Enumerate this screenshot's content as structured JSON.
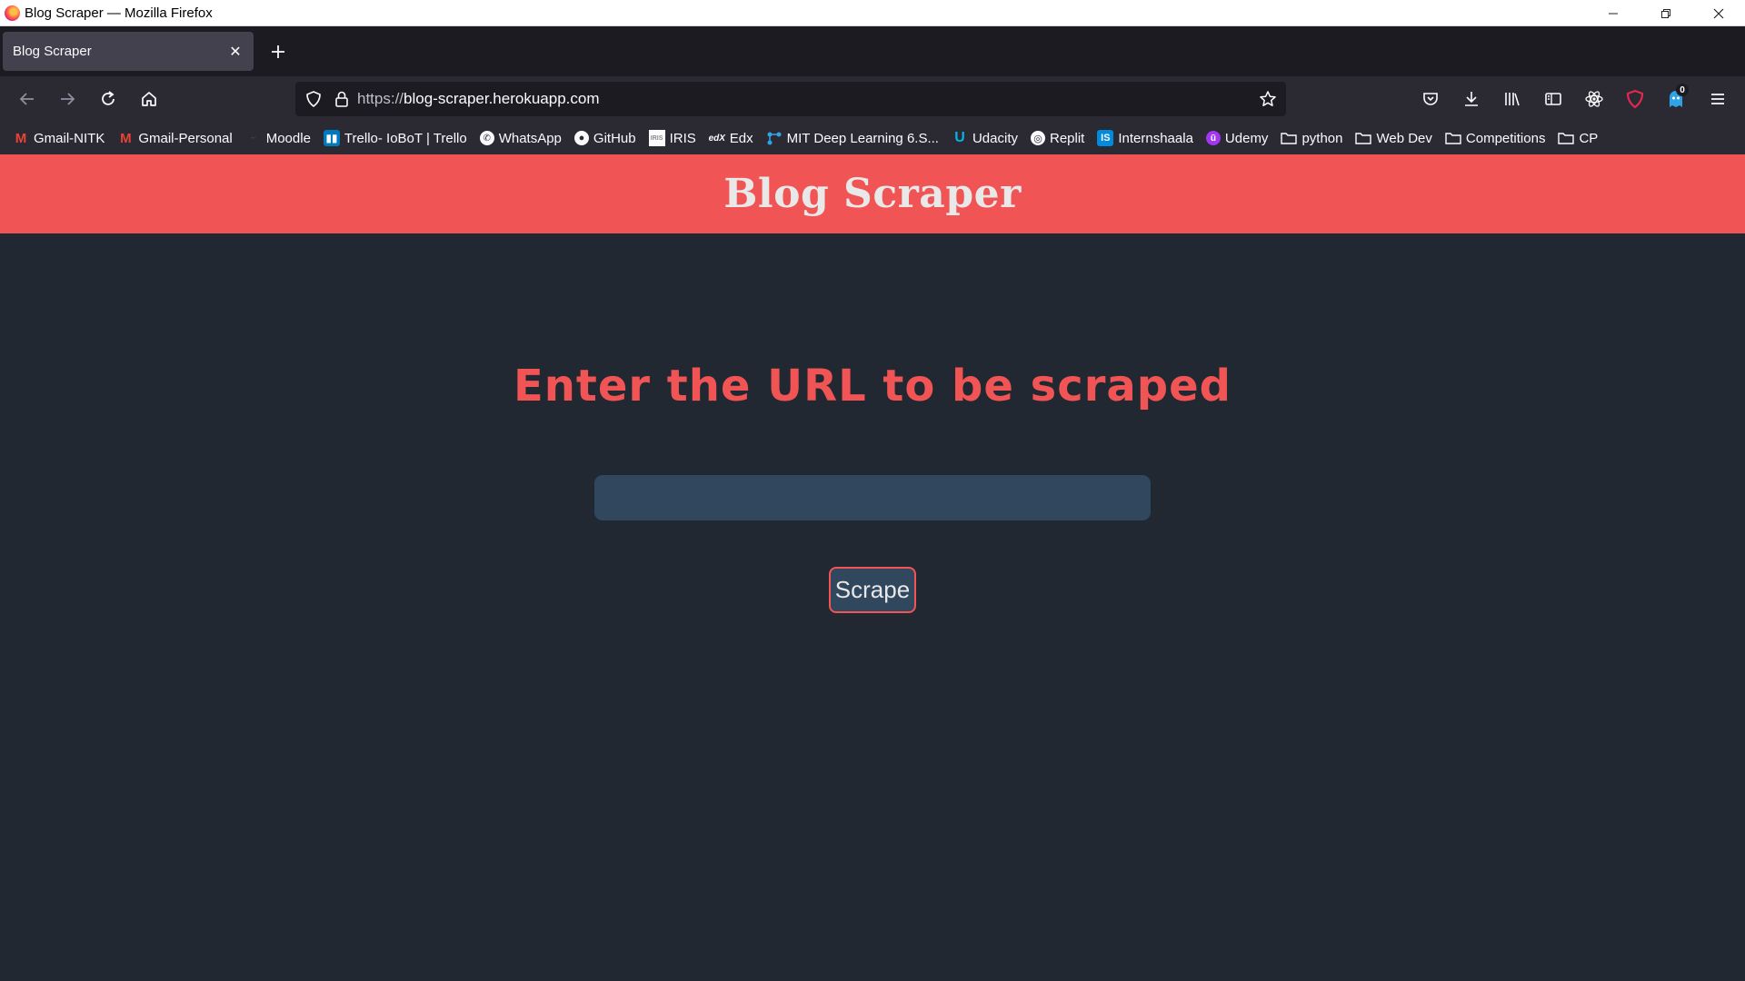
{
  "window": {
    "title": "Blog Scraper — Mozilla Firefox"
  },
  "tabs": [
    {
      "label": "Blog Scraper",
      "active": true
    }
  ],
  "address_bar": {
    "scheme": "https://",
    "host": "blog-scraper.herokuapp.com"
  },
  "toolbar": {
    "notification_count": "0"
  },
  "bookmarks": [
    {
      "label": "Gmail-NITK",
      "icon": "gmail-icon"
    },
    {
      "label": "Gmail-Personal",
      "icon": "gmail-icon"
    },
    {
      "label": "Moodle",
      "icon": "moodle-icon"
    },
    {
      "label": "Trello- IoBoT | Trello",
      "icon": "trello-icon"
    },
    {
      "label": "WhatsApp",
      "icon": "whatsapp-icon"
    },
    {
      "label": "GitHub",
      "icon": "github-icon"
    },
    {
      "label": "IRIS",
      "icon": "iris-icon"
    },
    {
      "label": "Edx",
      "icon": "edx-icon"
    },
    {
      "label": "MIT Deep Learning 6.S...",
      "icon": "mit-icon"
    },
    {
      "label": "Udacity",
      "icon": "udacity-icon"
    },
    {
      "label": "Replit",
      "icon": "replit-icon"
    },
    {
      "label": "Internshaala",
      "icon": "internshala-icon"
    },
    {
      "label": "Udemy",
      "icon": "udemy-icon"
    },
    {
      "label": "python",
      "icon": "folder-icon"
    },
    {
      "label": "Web Dev",
      "icon": "folder-icon"
    },
    {
      "label": "Competitions",
      "icon": "folder-icon"
    },
    {
      "label": "CP",
      "icon": "folder-icon"
    }
  ],
  "page": {
    "header_title": "Blog Scraper",
    "prompt": "Enter the URL to be scraped",
    "url_input_value": "",
    "scrape_button_label": "Scrape"
  },
  "colors": {
    "page_background": "#222831",
    "accent": "#f05454",
    "input_background": "#30475e",
    "header_text": "#e8e8e8"
  }
}
